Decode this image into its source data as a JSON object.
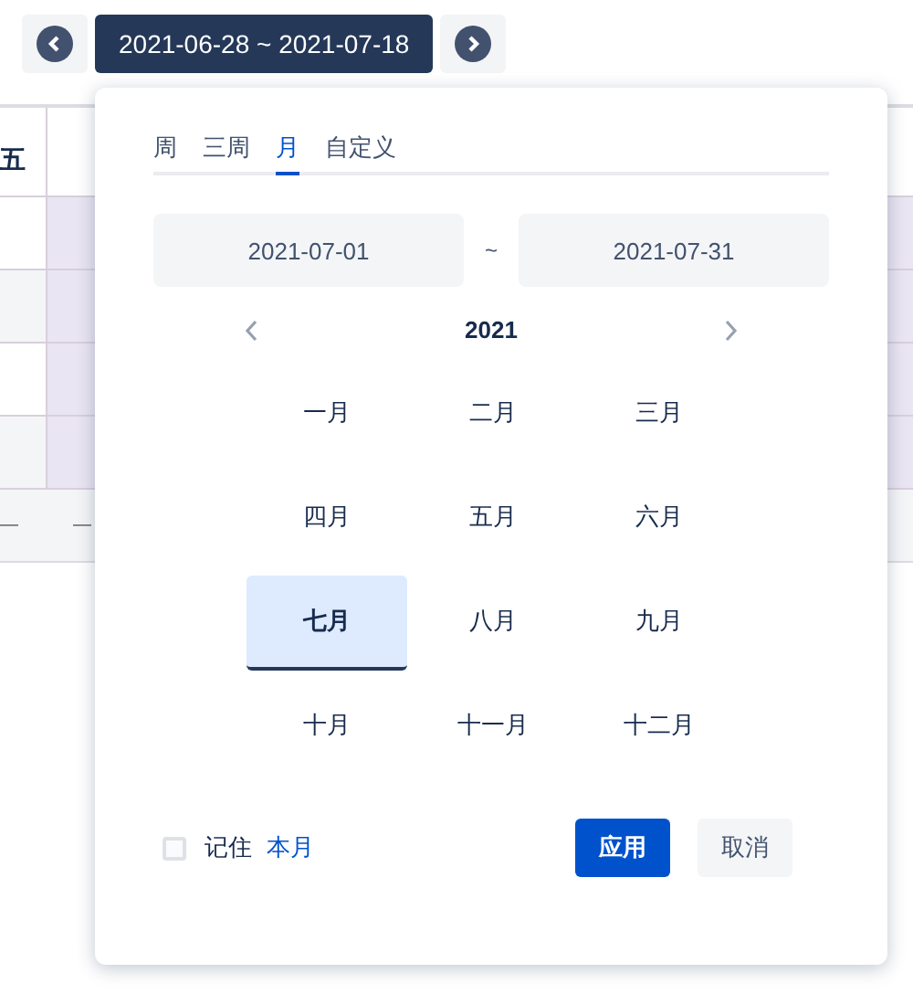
{
  "range_bar": {
    "label": "2021-06-28 ~ 2021-07-18"
  },
  "table": {
    "header_cell": "五",
    "footer_cells": [
      "—",
      "—"
    ]
  },
  "picker": {
    "tabs": [
      {
        "label": "周",
        "selected": false
      },
      {
        "label": "三周",
        "selected": false
      },
      {
        "label": "月",
        "selected": true
      },
      {
        "label": "自定义",
        "selected": false
      }
    ],
    "start_date": "2021-07-01",
    "separator": "~",
    "end_date": "2021-07-31",
    "year": "2021",
    "months": [
      {
        "label": "一月",
        "selected": false
      },
      {
        "label": "二月",
        "selected": false
      },
      {
        "label": "三月",
        "selected": false
      },
      {
        "label": "四月",
        "selected": false
      },
      {
        "label": "五月",
        "selected": false
      },
      {
        "label": "六月",
        "selected": false
      },
      {
        "label": "七月",
        "selected": true
      },
      {
        "label": "八月",
        "selected": false
      },
      {
        "label": "九月",
        "selected": false
      },
      {
        "label": "十月",
        "selected": false
      },
      {
        "label": "十一月",
        "selected": false
      },
      {
        "label": "十二月",
        "selected": false
      }
    ],
    "remember": {
      "checked": false,
      "label": "记住",
      "link": "本月"
    },
    "buttons": [
      {
        "label": "应用",
        "kind": "primary"
      },
      {
        "label": "取消",
        "kind": "secondary"
      }
    ]
  }
}
